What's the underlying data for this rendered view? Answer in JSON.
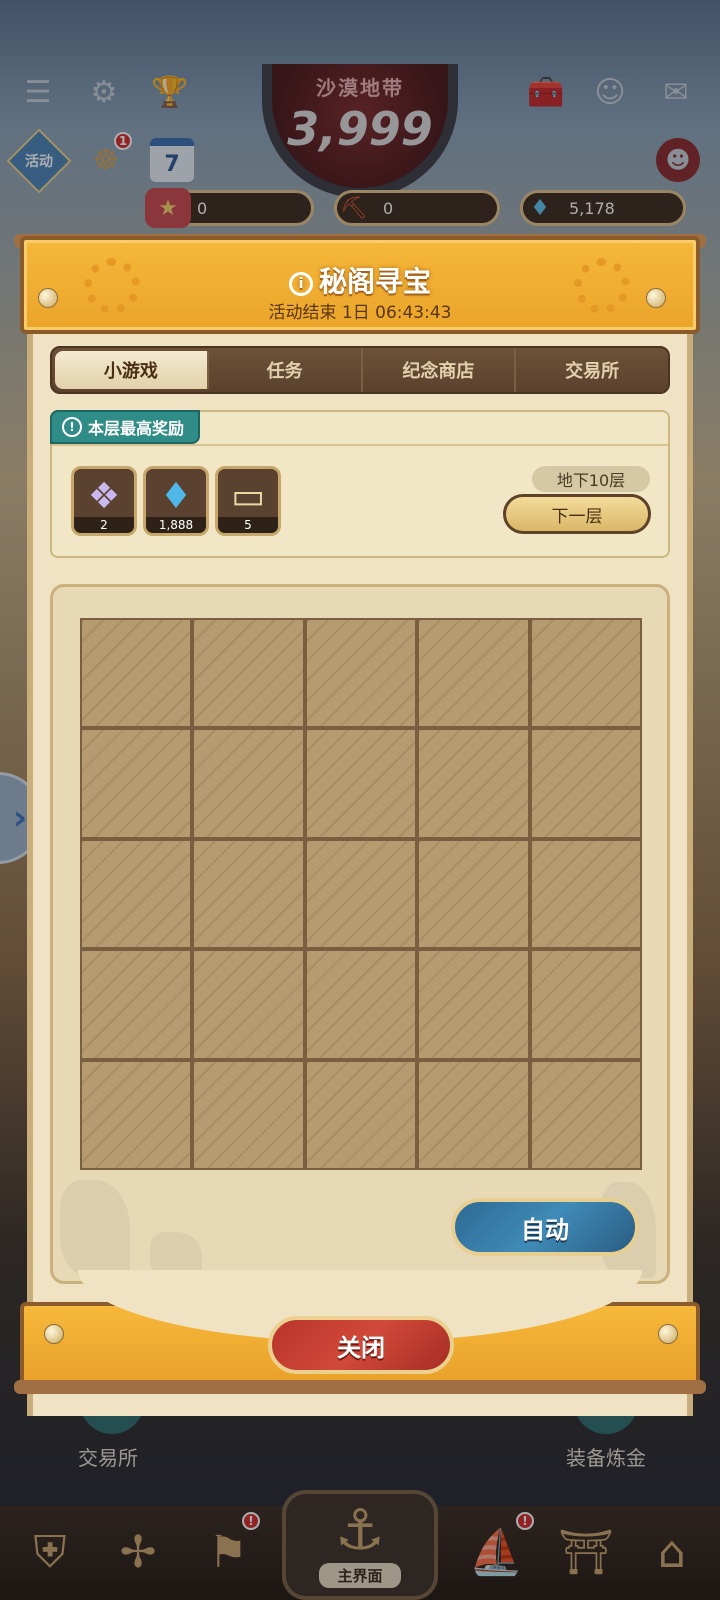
{
  "top_bar": {
    "zone_name": "沙漠地带",
    "zone_score": "3,999",
    "event_button_label": "活动",
    "calendar_day": "7",
    "wheel_badge": "1"
  },
  "resources": [
    {
      "icon": "ticket-icon",
      "value": "0"
    },
    {
      "icon": "shovel-icon",
      "value": "0"
    },
    {
      "icon": "diamond-icon",
      "value": "5,178"
    }
  ],
  "background": {
    "exchange_label": "交易所",
    "refine_label": "装备炼金"
  },
  "bottom_nav": {
    "main_label": "主界面"
  },
  "modal": {
    "title": "秘阁寻宝",
    "subtitle": "活动结束 1日 06:43:43",
    "tabs": [
      {
        "label": "小游戏",
        "active": true
      },
      {
        "label": "任务",
        "active": false
      },
      {
        "label": "纪念商店",
        "active": false
      },
      {
        "label": "交易所",
        "active": false
      }
    ],
    "reward_header": "本层最高奖励",
    "rewards": [
      {
        "icon": "crystal-icon",
        "qty": "2"
      },
      {
        "icon": "diamond-pile-icon",
        "qty": "1,888"
      },
      {
        "icon": "ticket-icon",
        "qty": "5"
      }
    ],
    "floor_label": "地下10层",
    "next_floor_label": "下一层",
    "auto_label": "自动",
    "close_label": "关闭"
  },
  "colors": {
    "accent_orange": "#f6b83a",
    "teal_tab": "#2f8c86",
    "auto_blue": "#2d6a94",
    "close_red": "#b8342a"
  }
}
